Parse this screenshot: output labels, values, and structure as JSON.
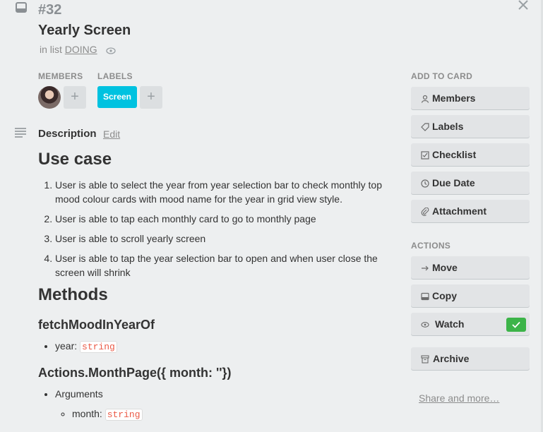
{
  "card": {
    "number": "#32",
    "title": "Yearly Screen",
    "in_list_prefix": "in list",
    "list_name": "DOING"
  },
  "sections": {
    "members": "MEMBERS",
    "labels": "LABELS",
    "add_to_card": "ADD TO CARD",
    "actions": "ACTIONS"
  },
  "labels": [
    {
      "text": "Screen",
      "color": "#00c2e0"
    }
  ],
  "add_symbol": "+",
  "description": {
    "heading": "Description",
    "edit": "Edit",
    "use_case_title": "Use case",
    "use_case_items": [
      "User is able to select the year from year selection bar to check monthly top mood colour cards with mood name for the year in grid view style.",
      "User is able to tap each monthly card to go to monthly page",
      "User is able to scroll yearly screen",
      "User is able to tap the year selection bar to open and when user close the screen will shrink"
    ],
    "methods_title": "Methods",
    "method1": {
      "name": "fetchMoodInYearOf",
      "param_label": "year:",
      "param_type": "string"
    },
    "method2": {
      "name": "Actions.MonthPage({ month: ''})",
      "args_label": "Arguments",
      "param_label": "month:",
      "param_type": "string"
    }
  },
  "add_to_card": [
    {
      "label": "Members",
      "icon": "person-icon"
    },
    {
      "label": "Labels",
      "icon": "tag-icon"
    },
    {
      "label": "Checklist",
      "icon": "checkbox-icon"
    },
    {
      "label": "Due Date",
      "icon": "clock-icon"
    },
    {
      "label": "Attachment",
      "icon": "paperclip-icon"
    }
  ],
  "actions": [
    {
      "label": "Move",
      "icon": "arrow-right-icon"
    },
    {
      "label": "Copy",
      "icon": "copy-card-icon"
    },
    {
      "label": "Watch",
      "icon": "eye-icon"
    },
    {
      "label": "Archive",
      "icon": "archive-icon"
    }
  ],
  "share_link": "Share and more…",
  "colors": {
    "label_cyan": "#00c2e0",
    "watch_check_green": "#3cb449",
    "code_red": "#eb5a46"
  }
}
